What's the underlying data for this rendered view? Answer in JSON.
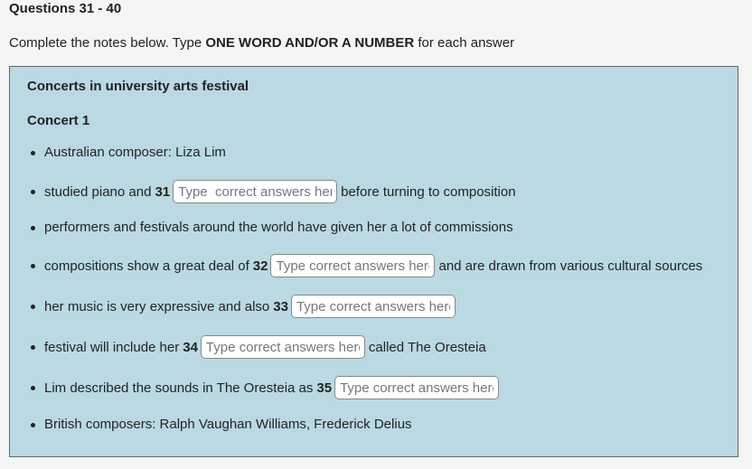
{
  "heading": "Questions 31 - 40",
  "instructions": {
    "prefix": "Complete the notes below. Type ",
    "bold": "ONE WORD AND/OR A NUMBER",
    "suffix": " for each answer"
  },
  "notes": {
    "title": "Concerts in university arts festival",
    "concert_title": "Concert 1",
    "items": [
      {
        "text": "Australian composer: Liza Lim"
      },
      {
        "before": "studied piano and",
        "number": "31",
        "placeholder": "Type  correct answers here",
        "value": "",
        "after": "before turning to composition"
      },
      {
        "text": "performers and festivals around the world have given her a lot of commissions"
      },
      {
        "before": "compositions show a great deal of",
        "number": "32",
        "placeholder": "Type correct answers here",
        "value": "",
        "after": "and are drawn from various cultural sources"
      },
      {
        "before": "her music is very expressive and also",
        "number": "33",
        "placeholder": "Type correct answers here",
        "value": "",
        "after": ""
      },
      {
        "before": "festival will include her",
        "number": "34",
        "placeholder": "Type correct answers here",
        "value": "",
        "after": "called The Oresteia"
      },
      {
        "before": "Lim described the sounds in The Oresteia as",
        "number": "35",
        "placeholder": "Type correct answers here",
        "value": "",
        "after": ""
      },
      {
        "text": "British composers: Ralph Vaughan Williams, Frederick Delius"
      }
    ]
  }
}
